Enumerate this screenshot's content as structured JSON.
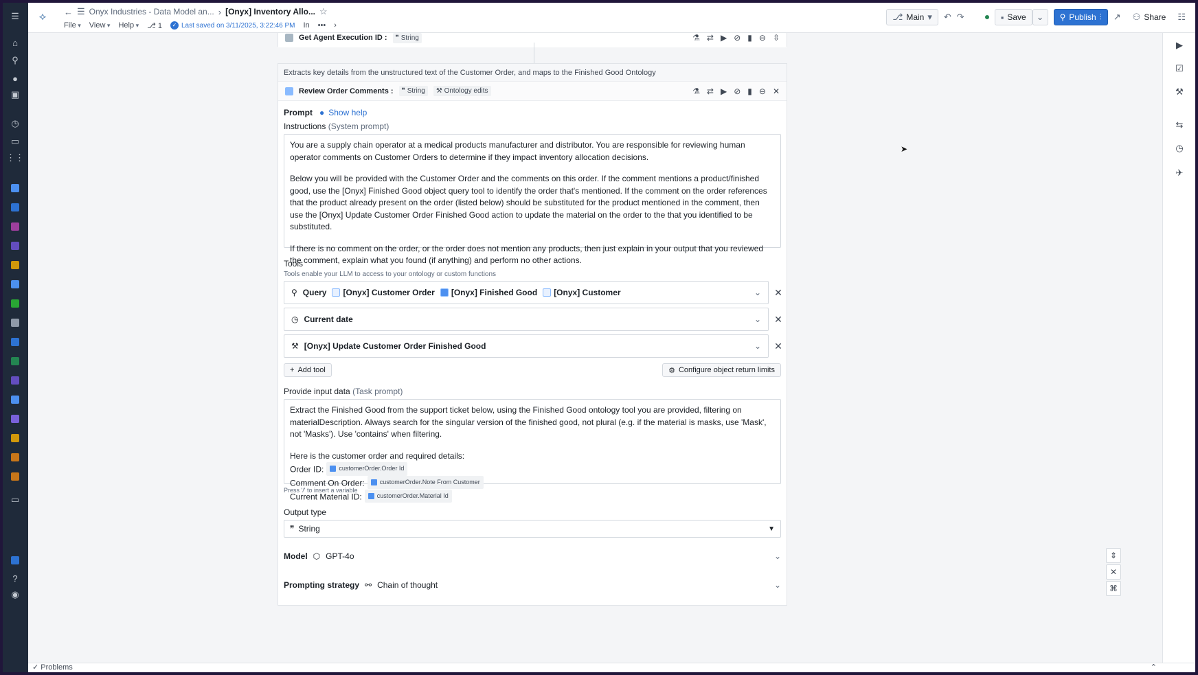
{
  "header": {
    "breadcrumb_parent": "Onyx Industries - Data Model an...",
    "title": "[Onyx] Inventory Allo...",
    "menus": [
      "File",
      "View",
      "Help"
    ],
    "counter": "1",
    "saved_text": "Last saved on 3/11/2025, 3:22:46 PM",
    "in_text": "In",
    "ellipsis": "•••",
    "branch": "Main",
    "save_label": "Save",
    "publish_label": "Publish",
    "share_label": "Share"
  },
  "top_node": {
    "name": "Get Agent Execution ID :",
    "type_tag": "String"
  },
  "main_node": {
    "description": "Extracts key details from the unstructured text of the Customer Order, and maps to the Finished Good Ontology",
    "name": "Review Order Comments :",
    "type_tag": "String",
    "edits_tag": "Ontology edits",
    "prompt_label": "Prompt",
    "show_help": "Show help",
    "instructions_label": "Instructions",
    "instructions_sub": "(System prompt)",
    "instructions": [
      "You are a supply chain operator at a medical products manufacturer and distributor. You are responsible for reviewing human operator comments on Customer Orders to determine if they impact inventory allocation decisions.",
      "Below you will be provided with the Customer Order and the comments on this order. If the comment mentions a product/finished good, use the [Onyx] Finished Good object query tool to identify the order that's mentioned. If the comment on the order references that the product already present on the order (listed below) should be substituted for the product mentioned in the comment, then use the [Onyx] Update Customer Order Finished Good action to update the material on the order to the that you identified to be substituted.",
      "If there is no comment on the order, or the order does not mention any products, then just explain in your output that you reviewed the comment, explain what you found (if anything) and perform no other actions."
    ],
    "tools_label": "Tools",
    "tools_sub": "Tools enable your LLM to access to your ontology or custom functions",
    "tools": {
      "query_label": "Query",
      "query_objects": [
        "[Onyx] Customer Order",
        "[Onyx] Finished Good",
        "[Onyx] Customer"
      ],
      "date_label": "Current date",
      "action_label": "[Onyx] Update Customer Order Finished Good"
    },
    "add_tool": "Add tool",
    "configure_limits": "Configure object return limits",
    "input_label": "Provide input data",
    "input_sub": "(Task prompt)",
    "task_text": "Extract the Finished Good from the support ticket below, using the Finished Good ontology tool you are provided, filtering on materialDescription. Always search for the singular version of the finished good, not plural (e.g. if the material is masks, use 'Mask', not 'Masks'). Use 'contains' when filtering.",
    "task_intro": "Here is the customer order and required details:",
    "vars": [
      {
        "label": "Order ID:",
        "value": "customerOrder.Order Id"
      },
      {
        "label": "Comment On Order:",
        "value": "customerOrder.Note From Customer"
      },
      {
        "label": "Current Material ID:",
        "value": "customerOrder.Material Id"
      }
    ],
    "insert_hint": "Press '/' to insert a variable",
    "output_label": "Output type",
    "output_value": "String",
    "model_label": "Model",
    "model_value": "GPT-4o",
    "strategy_label": "Prompting strategy",
    "strategy_value": "Chain of thought"
  },
  "footer": {
    "problems": "Problems"
  }
}
